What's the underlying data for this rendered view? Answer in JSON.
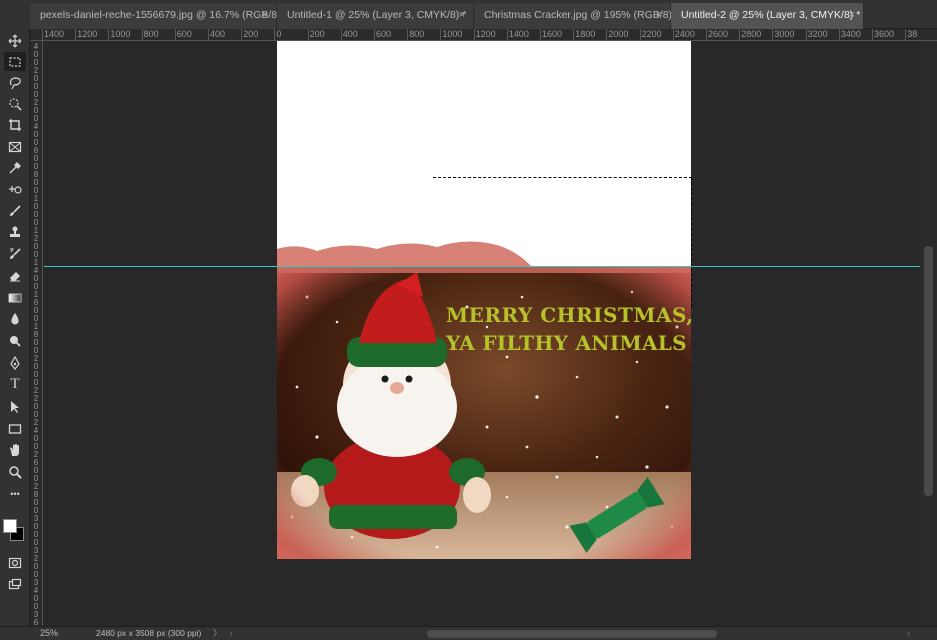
{
  "tabs": [
    {
      "label": "pexels-daniel-reche-1556679.jpg @ 16.7% (RGB/8)",
      "active": false
    },
    {
      "label": "Untitled-1 @ 25% (Layer 3, CMYK/8) *",
      "active": false
    },
    {
      "label": "Christmas Cracker.jpg @ 195% (RGB/8)",
      "active": false
    },
    {
      "label": "Untitled-2 @ 25% (Layer 3, CMYK/8) *",
      "active": true
    }
  ],
  "tab_close_glyph": "×",
  "ruler_top": [
    "1400",
    "1200",
    "1000",
    "800",
    "600",
    "400",
    "200",
    "0",
    "200",
    "400",
    "600",
    "800",
    "1000",
    "1200",
    "1400",
    "1600",
    "1800",
    "2000",
    "2200",
    "2400",
    "2600",
    "2800",
    "3000",
    "3200",
    "3400",
    "3600",
    "38"
  ],
  "ruler_left": [
    "4",
    "0",
    "0",
    "2",
    "0",
    "0",
    "0",
    "2",
    "0",
    "0",
    "4",
    "0",
    "0",
    "6",
    "0",
    "0",
    "8",
    "0",
    "0",
    "1",
    "0",
    "0",
    "0",
    "1",
    "2",
    "0",
    "0",
    "1",
    "4",
    "0",
    "0",
    "1",
    "6",
    "0",
    "0",
    "1",
    "8",
    "0",
    "0",
    "2",
    "0",
    "0",
    "0",
    "2",
    "2",
    "0",
    "0",
    "2",
    "4",
    "0",
    "0",
    "2",
    "6",
    "0",
    "0",
    "2",
    "8",
    "0",
    "0",
    "3",
    "0",
    "0",
    "0",
    "3",
    "2",
    "0",
    "0",
    "3",
    "4",
    "0",
    "0",
    "3",
    "6",
    "0",
    "0"
  ],
  "tools": [
    {
      "name": "move-tool-icon",
      "active": false
    },
    {
      "name": "rectangular-marquee-tool-icon",
      "active": true
    },
    {
      "name": "lasso-tool-icon",
      "active": false
    },
    {
      "name": "quick-selection-tool-icon",
      "active": false
    },
    {
      "name": "crop-tool-icon",
      "active": false
    },
    {
      "name": "frame-tool-icon",
      "active": false
    },
    {
      "name": "eyedropper-tool-icon",
      "active": false
    },
    {
      "name": "healing-brush-tool-icon",
      "active": false
    },
    {
      "name": "brush-tool-icon",
      "active": false
    },
    {
      "name": "clone-stamp-tool-icon",
      "active": false
    },
    {
      "name": "history-brush-tool-icon",
      "active": false
    },
    {
      "name": "eraser-tool-icon",
      "active": false
    },
    {
      "name": "gradient-tool-icon",
      "active": false
    },
    {
      "name": "blur-tool-icon",
      "active": false
    },
    {
      "name": "dodge-tool-icon",
      "active": false
    },
    {
      "name": "pen-tool-icon",
      "active": false
    },
    {
      "name": "type-tool-icon",
      "active": false
    },
    {
      "name": "path-selection-tool-icon",
      "active": false
    },
    {
      "name": "rectangle-tool-icon",
      "active": false
    },
    {
      "name": "hand-tool-icon",
      "active": false
    },
    {
      "name": "zoom-tool-icon",
      "active": false
    },
    {
      "name": "more-tools-icon",
      "active": false
    }
  ],
  "type_tool_glyph": "T",
  "more_tools_glyph": "•••",
  "card": {
    "greeting_line1": "MERRY CHRISTMAS,",
    "greeting_line2": "YA FILTHY ANIMALS",
    "greeting_color": "#b5c22a"
  },
  "guide_color": "#39c5c9",
  "status": {
    "zoom": "25%",
    "doc_info": "2480 px x 3508 px (300 ppi)",
    "arrow": "〉",
    "scroll_left": "‹",
    "scroll_right": "›"
  },
  "colors": {
    "foreground": "#ffffff",
    "background": "#000000"
  }
}
